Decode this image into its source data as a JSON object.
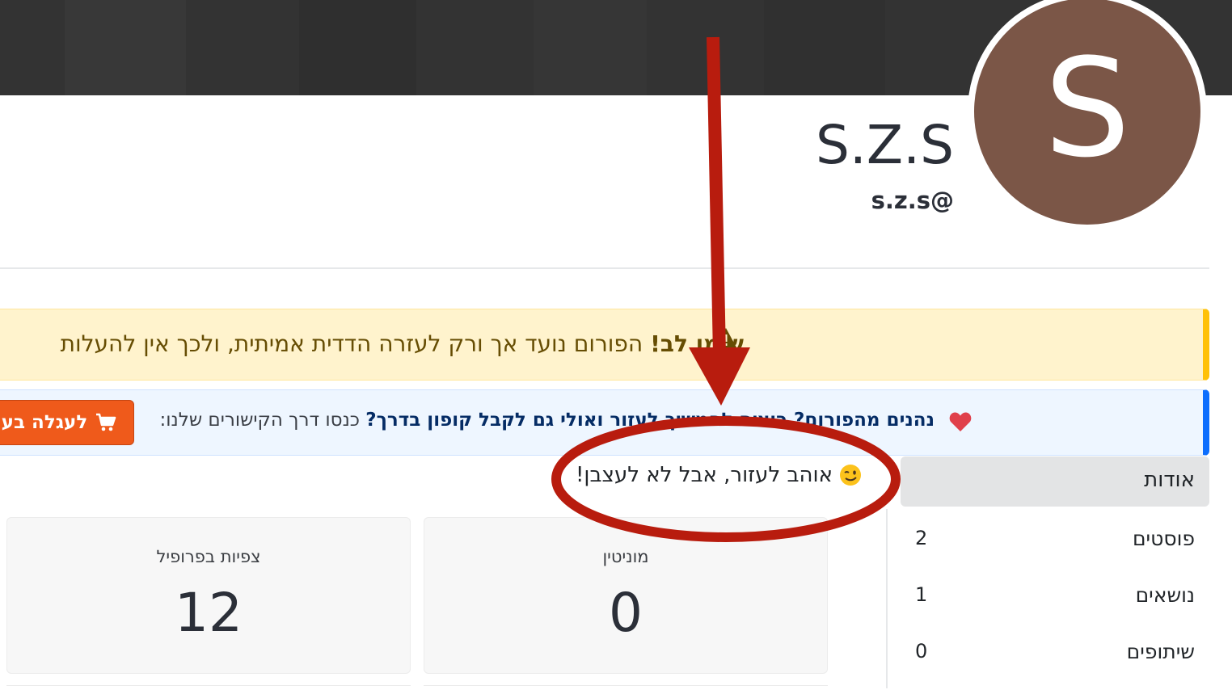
{
  "profile": {
    "avatar_letter": "S",
    "avatar_color": "#7b5647",
    "display_name": "S.Z.S",
    "handle": "s.z.s@"
  },
  "alerts": {
    "warning": {
      "strong": "שימו לב!",
      "text": "הפורום נועד אך ורק לעזרה הדדית אמיתית, ולכך אין להעלות",
      "color": "#ffc107"
    },
    "info": {
      "strong_a": "נהנים מהפורום? רוצים להמשיך לעזור ואולי גם לקבל קופון בדרך?",
      "text": "כנסו דרך הקישורים שלנו:",
      "button_label": "לעגלה בעלי",
      "color": "#0d6efd"
    }
  },
  "bio": {
    "text": "אוהב לעזור, אבל לא לעצבן!"
  },
  "sidebar": {
    "about_label": "אודות",
    "stats": [
      {
        "label": "פוסטים",
        "value": "2"
      },
      {
        "label": "נושאים",
        "value": "1"
      },
      {
        "label": "שיתופים",
        "value": "0"
      }
    ]
  },
  "cards": [
    {
      "title": "מוניטין",
      "value": "0"
    },
    {
      "title": "צפיות בפרופיל",
      "value": "12"
    }
  ],
  "annotation_color": "#b81c0e",
  "icons": [
    "warning-icon",
    "heart-icon",
    "cart-icon",
    "wink-emoji-icon",
    "arrow-annotation",
    "circle-annotation"
  ]
}
